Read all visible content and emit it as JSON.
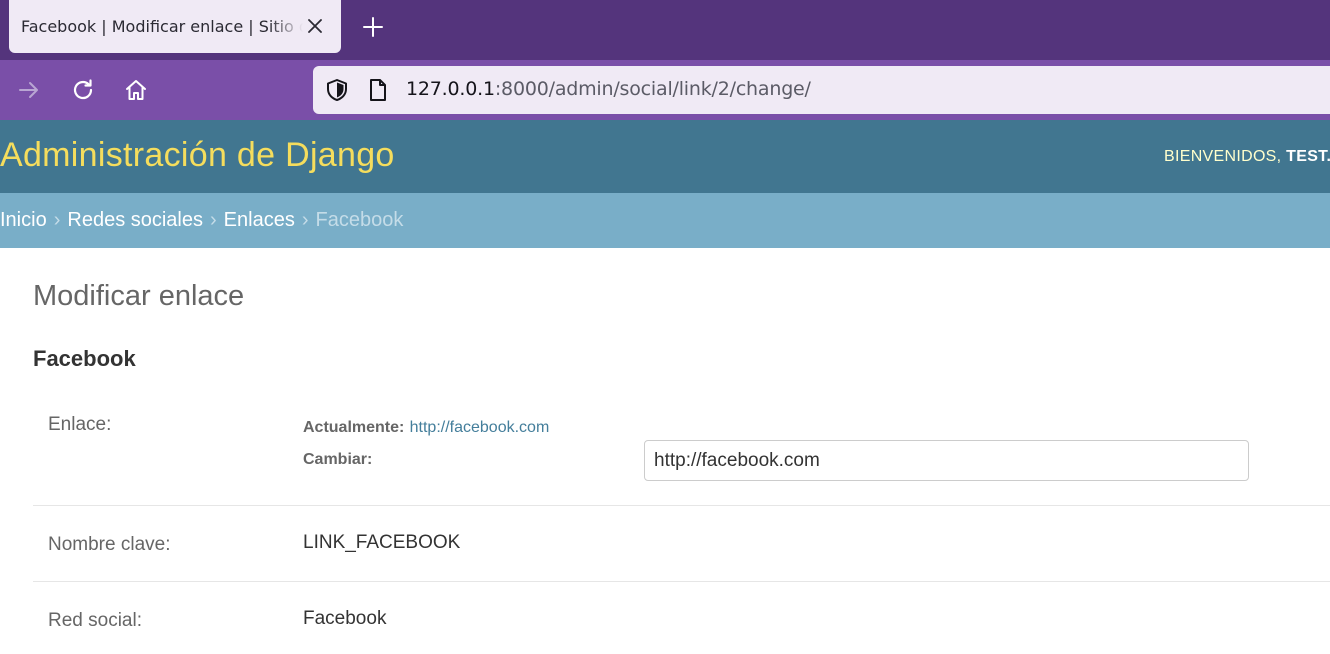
{
  "browser": {
    "tab_title": "Facebook | Modificar enlace | Sitio de administración de Django",
    "url_host": "127.0.0.1",
    "url_path": ":8000/admin/social/link/2/change/"
  },
  "header": {
    "branding": "Administración de Django",
    "welcome": "BIENVENIDOS,",
    "username": "TEST."
  },
  "breadcrumbs": {
    "home": "Inicio",
    "app": "Redes sociales",
    "model": "Enlaces",
    "current": "Facebook",
    "separator": "›"
  },
  "content": {
    "title": "Modificar enlace",
    "object_title": "Facebook"
  },
  "form": {
    "url_field": {
      "label": "Enlace:",
      "current_label": "Actualmente:",
      "current_value": "http://facebook.com",
      "change_label": "Cambiar:",
      "input_value": "http://facebook.com"
    },
    "key_field": {
      "label": "Nombre clave:",
      "value": "LINK_FACEBOOK"
    },
    "network_field": {
      "label": "Red social:",
      "value": "Facebook"
    }
  },
  "colors": {
    "tabbar": "#54347c",
    "navbar": "#7a4fa8",
    "django_header": "#417690",
    "branding": "#f5dd5d",
    "breadcrumbs": "#79aec8",
    "link": "#447e9b"
  },
  "icons": [
    "close-icon",
    "plus-icon",
    "forward-arrow-icon",
    "reload-icon",
    "home-icon",
    "shield-icon",
    "page-icon"
  ]
}
